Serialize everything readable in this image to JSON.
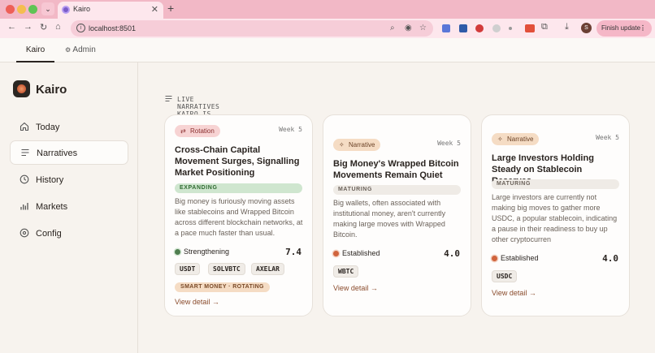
{
  "browser": {
    "tab_title": "Kairo",
    "url": "localhost:8501",
    "finish_update": "Finish update",
    "profile_initial": "S",
    "colors": {
      "chrome": "#f2b8c6",
      "toolbar": "#fde7ed"
    }
  },
  "appnav": {
    "tabs": [
      {
        "label": "Kairo"
      },
      {
        "label": "Admin"
      }
    ]
  },
  "sidebar": {
    "brand": "Kairo",
    "items": [
      {
        "label": "Today",
        "icon": "home-icon"
      },
      {
        "label": "Narratives",
        "icon": "list-icon"
      },
      {
        "label": "History",
        "icon": "clock-icon"
      },
      {
        "label": "Markets",
        "icon": "bar-chart-icon"
      },
      {
        "label": "Config",
        "icon": "settings-icon"
      }
    ]
  },
  "main": {
    "section_label": "LIVE NARRATIVES KAIRO IS TRACKING",
    "cards": [
      {
        "badge": "Rotation",
        "week": "Week 5",
        "title": "Cross-Chain Capital Movement Surges, Signalling Market Positioning",
        "stage": "EXPANDING",
        "summary": "Big money is furiously moving assets like stablecoins and Wrapped Bitcoin across different blockchain networks, at a pace much faster than usual.",
        "trend": "Strengthening",
        "score": "7.4",
        "chips": [
          "USDT",
          "SOLVBTC",
          "AXELAR"
        ],
        "signal": "SMART MONEY · ROTATING",
        "detail": "View detail →"
      },
      {
        "badge": "Narrative",
        "week": "Week 5",
        "title": "Big Money's Wrapped Bitcoin Movements Remain Quiet",
        "stage": "MATURING",
        "summary": "Big wallets, often associated with institutional money, aren't currently making large moves with Wrapped Bitcoin.",
        "trend": "Established",
        "score": "4.0",
        "chips": [
          "WBTC"
        ],
        "detail": "View detail →"
      },
      {
        "badge": "Narrative",
        "week": "Week 5",
        "title": "Large Investors Holding Steady on Stablecoin Reserves",
        "stage": "MATURING",
        "summary": "Large investors are currently not making big moves to gather more USDC, a popular stablecoin, indicating a pause in their readiness to buy up other cryptocurren",
        "trend": "Established",
        "score": "4.0",
        "chips": [
          "USDC"
        ],
        "detail": "View detail →"
      }
    ]
  }
}
